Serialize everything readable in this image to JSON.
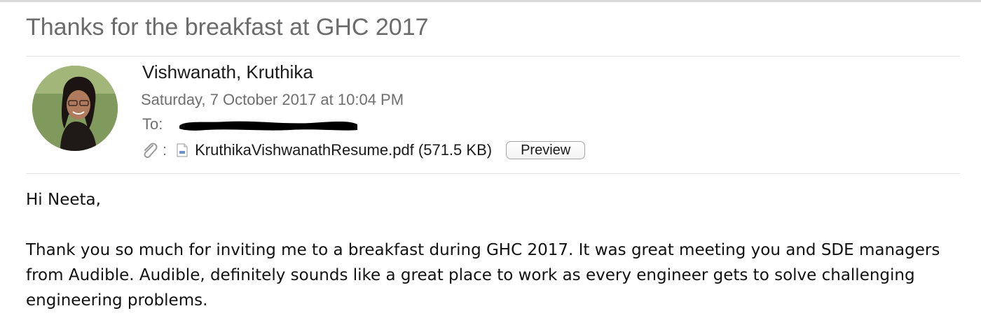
{
  "message": {
    "subject": "Thanks for the breakfast at GHC 2017",
    "sender": "Vishwanath, Kruthika",
    "date": "Saturday, 7 October 2017 at 10:04 PM",
    "to_label": "To:",
    "attachment": {
      "label": ":",
      "icon": "paperclip-icon",
      "file_icon": "pdf-icon",
      "text": "KruthikaVishwanathResume.pdf (571.5 KB)",
      "preview_label": "Preview"
    },
    "body": {
      "greeting": "Hi Neeta,",
      "paragraph": "Thank you so much for inviting me to a breakfast during GHC 2017. It was great meeting you and SDE managers from Audible. Audible, definitely sounds like a great place to work as every engineer gets to solve challenging engineering problems."
    }
  },
  "colors": {
    "subject": "#6b6b6b",
    "meta": "#6f6f6f",
    "divider": "#e3e3e3"
  }
}
